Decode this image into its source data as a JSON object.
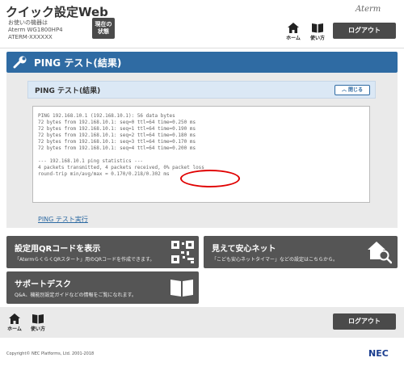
{
  "header": {
    "app_title": "クイック設定Web",
    "device_caption": "お使いの機器は",
    "device_model": "Aterm WG1800HP4",
    "device_ssid": "ATERM-XXXXXX",
    "state_button_line1": "現在の",
    "state_button_line2": "状態",
    "brand": "Aterm",
    "nav_home": "ホーム",
    "nav_help": "使い方",
    "logout": "ログアウト"
  },
  "page": {
    "title": "PING テスト(結果)",
    "section_title": "PING テスト(結果)",
    "close_label": "閉じる"
  },
  "ping_output": [
    "PING 192.168.10.1 (192.168.10.1): 56 data bytes",
    "72 bytes from 192.168.10.1: seq=0 ttl=64 time=0.250 ms",
    "72 bytes from 192.168.10.1: seq=1 ttl=64 time=0.190 ms",
    "72 bytes from 192.168.10.1: seq=2 ttl=64 time=0.180 ms",
    "72 bytes from 192.168.10.1: seq=3 ttl=64 time=0.170 ms",
    "72 bytes from 192.168.10.1: seq=4 ttl=64 time=0.200 ms",
    "",
    "--- 192.168.10.1 ping statistics ---",
    "4 packets transmitted, 4 packets received, 0% packet loss",
    "round-trip min/avg/max = 0.170/0.218/0.302 ms"
  ],
  "run_link": "PING テスト実行",
  "tiles": {
    "qr_title": "設定用QRコードを表示",
    "qr_desc": "「AtermらくらくQRスタート」用のQRコードを作成できます。",
    "safe_title": "見えて安心ネット",
    "safe_desc": "「こども安心ネットタイマー」などの設定はこちらから。",
    "support_title": "サポートデスク",
    "support_desc": "Q&A、機能別設定ガイドなどの情報をご覧になれます。"
  },
  "footer": {
    "nav_home": "ホーム",
    "nav_help": "使い方",
    "logout": "ログアウト",
    "copyright": "Copyright© NEC Platforms, Ltd. 2001-2018",
    "brand": "NEC"
  },
  "colors": {
    "accent": "#2f6ba3",
    "tile": "#555555",
    "highlight": "#e00000"
  }
}
